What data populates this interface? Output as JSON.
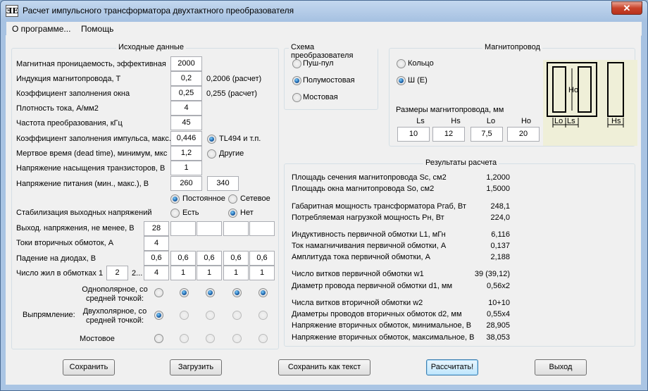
{
  "window": {
    "title": "Расчет импульсного трансформатора двухтактного преобразователя",
    "icon_text": "ƎE",
    "close": "✕"
  },
  "menu": [
    "О программе...",
    "Помощь"
  ],
  "source": {
    "title": "Исходные данные",
    "rows": [
      {
        "label": "Магнитная проницаемость, эффективная",
        "value": "2000"
      },
      {
        "label": "Индукция магнитопровода, Т",
        "value": "0,2",
        "note": "0,2006 (расчет)"
      },
      {
        "label": "Коэффициент заполнения окна",
        "value": "0,25",
        "note": "0,255 (расчет)"
      },
      {
        "label": "Плотность тока, А/мм2",
        "value": "4"
      },
      {
        "label": "Частота преобразования, кГц",
        "value": "45"
      },
      {
        "label": "Коэффициент заполнения импульса, макс.",
        "value": "0,446"
      },
      {
        "label": "Мертвое время (dead time), минимум, мкс",
        "value": "1,2"
      },
      {
        "label": "Напряжение насыщения транзисторов, В",
        "value": "1"
      },
      {
        "label": "Напряжение питания (мин., макс.), В",
        "value": "260",
        "value2": "340"
      }
    ],
    "controller_options": [
      "TL494 и т.п.",
      "Другие"
    ],
    "supply_options": [
      "Постоянное",
      "Сетевое"
    ],
    "stabilization": {
      "label": "Стабилизация выходных напряжений",
      "options": [
        "Есть",
        "Нет"
      ]
    },
    "out_voltage": {
      "label": "Выход. напряжения, не менее, В",
      "values": [
        "28",
        "",
        "",
        "",
        ""
      ]
    },
    "sec_current": {
      "label": "Токи вторичных обмоток, А",
      "values": [
        "4",
        "",
        "",
        "",
        ""
      ]
    },
    "diode_drop": {
      "label": "Падение на диодах, В",
      "values": [
        "0,6",
        "0,6",
        "0,6",
        "0,6",
        "0,6"
      ]
    },
    "strands": {
      "label": "Число жил в обмотках 1",
      "primary": "2",
      "sep": "2...",
      "values": [
        "4",
        "1",
        "1",
        "1",
        "1"
      ]
    },
    "rectification": {
      "label": "Выпрямление:",
      "modes": [
        "Однополярное, со средней точкой:",
        "Двухполярное, со средней точкой:",
        "Мостовое"
      ],
      "selected": [
        1,
        0,
        0,
        0,
        0
      ]
    }
  },
  "scheme": {
    "title": "Схема преобразователя",
    "options": [
      "Пуш-пул",
      "Полумостовая",
      "Мостовая"
    ],
    "selected": 1
  },
  "core": {
    "title": "Магнитопровод",
    "options": [
      "Кольцо",
      "Ш (Е)"
    ],
    "selected": 1,
    "dims_label": "Размеры магнитопровода, мм",
    "dims": [
      {
        "name": "Ls",
        "value": "10"
      },
      {
        "name": "Hs",
        "value": "12"
      },
      {
        "name": "Lo",
        "value": "7,5"
      },
      {
        "name": "Ho",
        "value": "20"
      }
    ],
    "diagram": {
      "ho": "Ho",
      "lo": "Lo",
      "ls": "Ls",
      "hs": "Hs"
    }
  },
  "results": {
    "title": "Результаты расчета",
    "rows": [
      {
        "label": "Площадь сечения магнитопровода Sc, см2",
        "value": "1,2000"
      },
      {
        "label": "Площадь окна магнитопровода So, см2",
        "value": "1,5000"
      },
      {
        "label": "Габаритная мощность трансформатора Pгаб, Вт",
        "value": "248,1"
      },
      {
        "label": "Потребляемая нагрузкой мощность Pн, Вт",
        "value": "224,0"
      },
      {
        "label": "Индуктивность первичной обмотки L1, мГн",
        "value": "6,116"
      },
      {
        "label": "Ток намагничивания первичной обмотки, А",
        "value": "0,137"
      },
      {
        "label": "Амплитуда тока первичной обмотки, А",
        "value": "2,188"
      },
      {
        "label": "Число витков первичной обмотки w1",
        "value": "39 (39,12)"
      },
      {
        "label": "Диаметр провода первичной обмотки d1, мм",
        "value": "0,56x2"
      },
      {
        "label": "Числа витков вторичной обмотки w2",
        "value": "10+10"
      },
      {
        "label": "Диаметры проводов вторичных обмоток d2, мм",
        "value": "0,55x4"
      },
      {
        "label": "Напряжение вторичных обмоток, минимальное, В",
        "value": "28,905"
      },
      {
        "label": "Напряжение вторичных обмоток, максимальное, В",
        "value": "38,053"
      }
    ]
  },
  "buttons": {
    "save": "Сохранить",
    "load": "Загрузить",
    "save_text": "Сохранить как текст",
    "calc": "Рассчитать!",
    "exit": "Выход"
  }
}
